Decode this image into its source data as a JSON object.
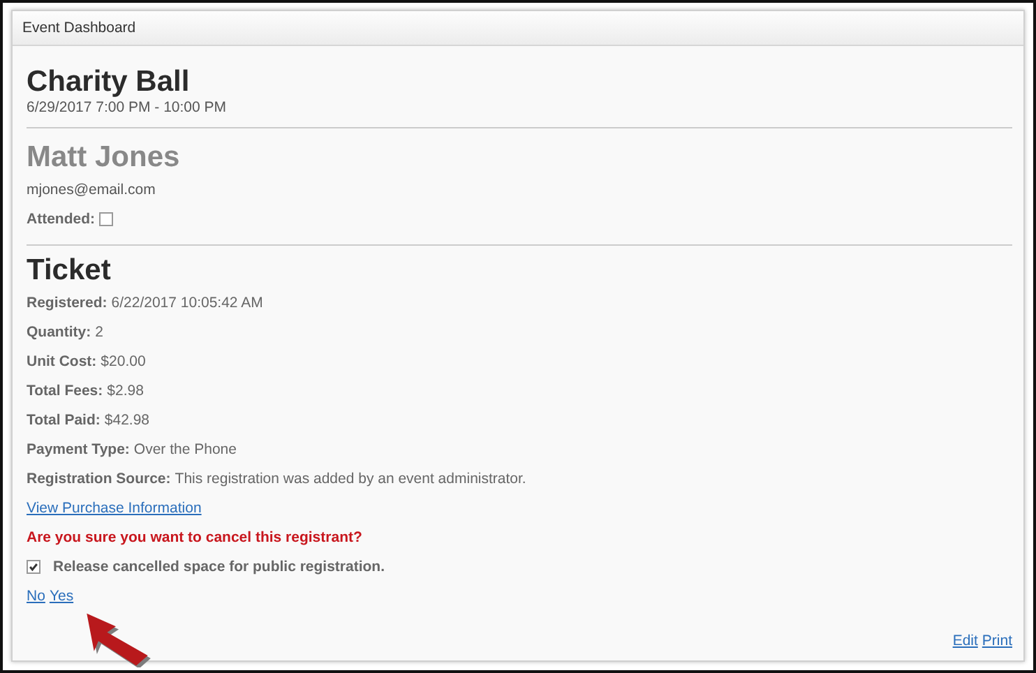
{
  "panel": {
    "title": "Event Dashboard"
  },
  "event": {
    "name": "Charity Ball",
    "when": "6/29/2017 7:00 PM - 10:00 PM"
  },
  "attendee": {
    "name": "Matt Jones",
    "email": "mjones@email.com",
    "attended_label": "Attended:",
    "attended": false
  },
  "ticket": {
    "heading": "Ticket",
    "fields": [
      {
        "label": "Registered:",
        "value": "6/22/2017 10:05:42 AM"
      },
      {
        "label": "Quantity:",
        "value": "2"
      },
      {
        "label": "Unit Cost:",
        "value": "$20.00"
      },
      {
        "label": "Total Fees:",
        "value": "$2.98"
      },
      {
        "label": "Total Paid:",
        "value": "$42.98"
      },
      {
        "label": "Payment Type:",
        "value": "Over the Phone"
      },
      {
        "label": "Registration Source:",
        "value": "This registration was added by an event administrator."
      }
    ],
    "purchase_link": "View Purchase Information"
  },
  "cancel": {
    "question": "Are you sure you want to cancel this registrant?",
    "release_label": "Release cancelled space for public registration.",
    "release": true,
    "no": "No",
    "yes": "Yes"
  },
  "footer_links": [
    "Edit",
    "Print"
  ]
}
